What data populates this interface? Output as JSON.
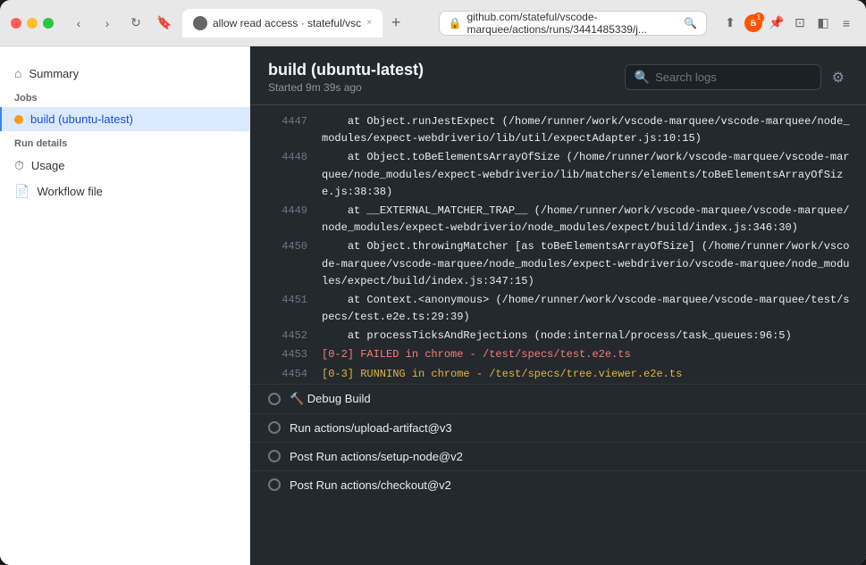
{
  "window": {
    "title": "allow read access · stateful/vsc"
  },
  "titlebar": {
    "traffic_lights": [
      "close",
      "minimize",
      "maximize"
    ],
    "tab_label": "allow read access · stateful/vsc",
    "tab_close": "×",
    "new_tab": "+",
    "address": "github.com/stateful/vscode-marquee/actions/runs/3441485339/j...",
    "address_icon": "🔒"
  },
  "sidebar": {
    "summary_label": "Summary",
    "jobs_section": "Jobs",
    "build_job_label": "build (ubuntu-latest)",
    "run_details_section": "Run details",
    "usage_label": "Usage",
    "workflow_file_label": "Workflow file"
  },
  "panel": {
    "title": "build (ubuntu-latest)",
    "subtitle": "Started 9m 39s ago",
    "search_placeholder": "Search logs",
    "settings_label": "⚙"
  },
  "log_lines": [
    {
      "num": "4447",
      "text": "    at Object.runJestExpect (/home/runner/work/vscode-marquee/vscode-marquee/node_modules/expect-webdriverio/lib/util/expectAdapter.js:10:15)"
    },
    {
      "num": "4448",
      "text": "    at Object.toBeElementsArrayOfSize (/home/runner/work/vscode-marquee/vscode-marquee/node_modules/expect-webdriverio/lib/matchers/elements/toBeElementsArrayOfSize.js:38:38)"
    },
    {
      "num": "4449",
      "text": "    at __EXTERNAL_MATCHER_TRAP__ (/home/runner/work/vscode-marquee/vscode-marquee/node_modules/expect-webdriverio/node_modules/expect/build/index.js:346:30)"
    },
    {
      "num": "4450",
      "text": "    at Object.throwingMatcher [as toBeElementsArrayOfSize] (/home/runner/work/vscode-marquee/vscode-marquee/node_modules/expect-webdriverio/vscode-marquee/node_modules/expect/build/index.js:347:15)"
    },
    {
      "num": "4451",
      "text": "    at Context.<anonymous> (/home/runner/work/vscode-marquee/vscode-marquee/test/specs/test.e2e.ts:29:39)"
    },
    {
      "num": "4452",
      "text": "    at processTicksAndRejections (node:internal/process/task_queues:96:5)"
    },
    {
      "num": "4453",
      "text": "[0-2] FAILED in chrome - /test/specs/test.e2e.ts",
      "color": "red"
    },
    {
      "num": "4454",
      "text": "[0-3] RUNNING in chrome - /test/specs/tree.viewer.e2e.ts",
      "color": "yellow"
    }
  ],
  "steps": [
    {
      "label": "🔨 Debug Build",
      "status": "pending"
    },
    {
      "label": "Run actions/upload-artifact@v3",
      "status": "pending"
    },
    {
      "label": "Post Run actions/setup-node@v2",
      "status": "pending"
    },
    {
      "label": "Post Run actions/checkout@v2",
      "status": "pending"
    }
  ],
  "colors": {
    "accent_blue": "#3b82f6",
    "bg_dark": "#24292e",
    "text_muted": "#8b949e",
    "text_main": "#e6edf3",
    "line_red": "#ff7b72",
    "line_yellow": "#e3b341"
  }
}
